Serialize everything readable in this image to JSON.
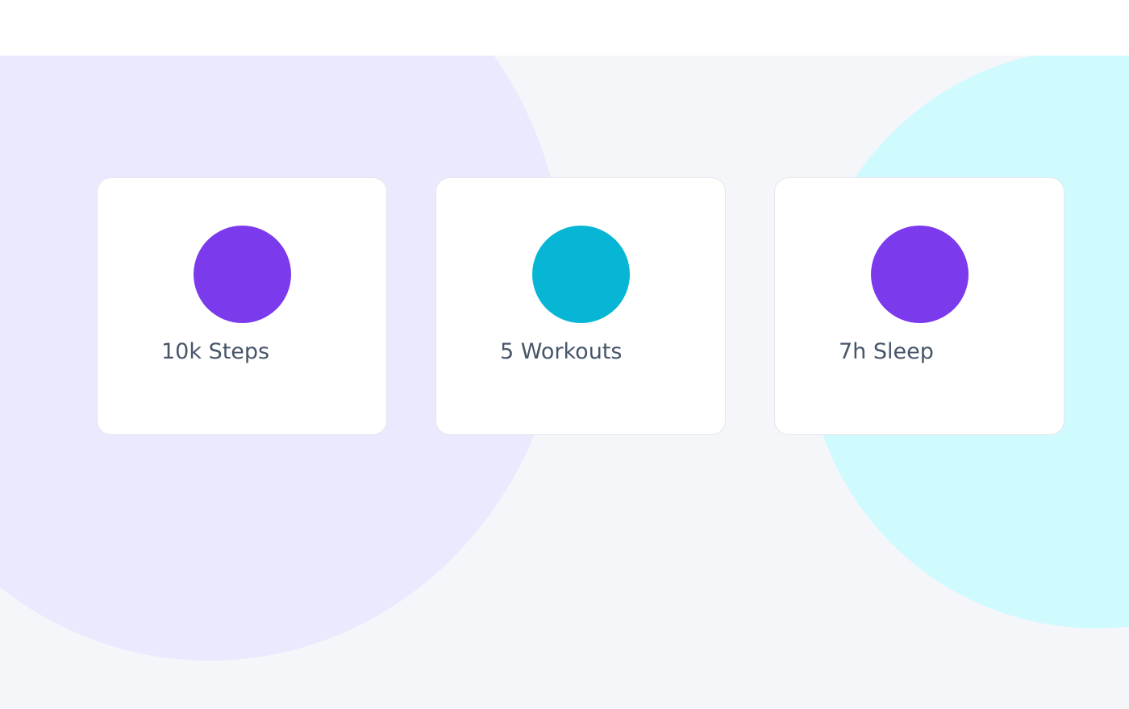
{
  "colors": {
    "background": "#f5f6fa",
    "header": "#ffffff",
    "blob_left": "#ebe9fe",
    "blob_right": "#cffafe",
    "card_bg": "#ffffff",
    "label_text": "#475569"
  },
  "cards": [
    {
      "label": "10k Steps",
      "icon": "purple-circle-icon",
      "color": "#7c3aed"
    },
    {
      "label": "5 Workouts",
      "icon": "cyan-circle-icon",
      "color": "#06b6d4"
    },
    {
      "label": "7h Sleep",
      "icon": "purple-circle-icon",
      "color": "#7c3aed"
    }
  ]
}
